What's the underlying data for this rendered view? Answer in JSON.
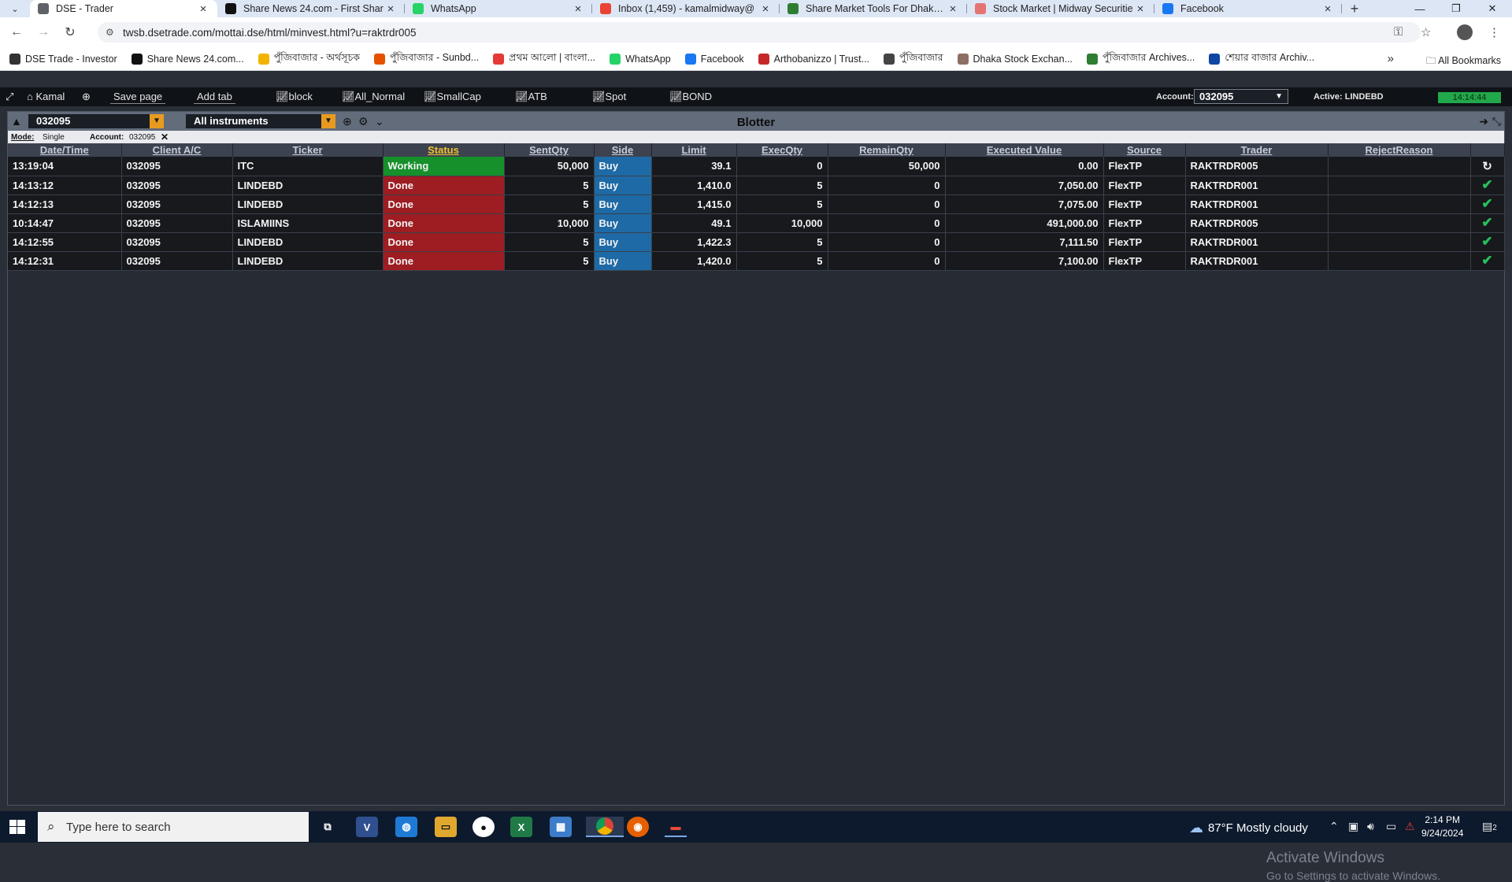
{
  "browser": {
    "tabs": [
      {
        "title": "DSE - Trader",
        "color": "#5f6368",
        "active": true
      },
      {
        "title": "Share News 24.com - First Shar",
        "color": "#111111"
      },
      {
        "title": "WhatsApp",
        "color": "#25d366"
      },
      {
        "title": "Inbox (1,459) - kamalmidway@",
        "color": "#ea4335"
      },
      {
        "title": "Share Market Tools For Dhaka S",
        "color": "#2e7d32"
      },
      {
        "title": "Stock Market | Midway Securitie",
        "color": "#e57373"
      },
      {
        "title": "Facebook",
        "color": "#1877f2"
      }
    ],
    "url": "twsb.dsetrade.com/mottai.dse/html/minvest.html?u=raktrdr005",
    "bookmarks": [
      {
        "label": "DSE Trade - Investor",
        "color": "#333333"
      },
      {
        "label": "Share News 24.com...",
        "color": "#111111"
      },
      {
        "label": "পুঁজিবাজার - অর্থসূচক",
        "color": "#f2b400"
      },
      {
        "label": "পুঁজিবাজার - Sunbd...",
        "color": "#e65100"
      },
      {
        "label": "প্রথম আলো | বাংলা...",
        "color": "#e53935"
      },
      {
        "label": "WhatsApp",
        "color": "#25d366"
      },
      {
        "label": "Facebook",
        "color": "#1877f2"
      },
      {
        "label": "Arthobanizzo | Trust...",
        "color": "#c62828"
      },
      {
        "label": "পুঁজিবাজার",
        "color": "#444444"
      },
      {
        "label": "Dhaka Stock Exchan...",
        "color": "#8d6e63"
      },
      {
        "label": "পুঁজিবাজার Archives...",
        "color": "#2e7d32"
      },
      {
        "label": "শেয়ার বাজার Archiv...",
        "color": "#0d47a1"
      }
    ],
    "all_bookmarks": "All Bookmarks"
  },
  "toolbar": {
    "user": "Kamal",
    "save_page": "Save page",
    "add_tab": "Add tab",
    "tabs": [
      "block",
      "All_Normal",
      "SmallCap",
      "ATB",
      "Spot",
      "BOND"
    ],
    "account_label": "Account:",
    "account_value": "032095",
    "active_label": "Active: LINDEBD",
    "clock": "14:14:44"
  },
  "blotter": {
    "title": "Blotter",
    "account_filter": "032095",
    "instrument_filter": "All instruments",
    "mode_label": "Mode:",
    "mode_value": "Single",
    "account_label": "Account:",
    "account_value": "032095",
    "columns": [
      "Date/Time",
      "Client A/C",
      "Ticker",
      "Status",
      "SentQty",
      "Side",
      "Limit",
      "ExecQty",
      "RemainQty",
      "Executed Value",
      "Source",
      "Trader",
      "RejectReason",
      ""
    ],
    "rows": [
      {
        "time": "13:19:04",
        "client": "032095",
        "ticker": "ITC",
        "status": "Working",
        "sent": "50,000",
        "side": "Buy",
        "limit": "39.1",
        "exec": "0",
        "remain": "50,000",
        "value": "0.00",
        "source": "FlexTP",
        "trader": "RAKTRDR005",
        "reject": "",
        "state": "↻"
      },
      {
        "time": "14:13:12",
        "client": "032095",
        "ticker": "LINDEBD",
        "status": "Done",
        "sent": "5",
        "side": "Buy",
        "limit": "1,410.0",
        "exec": "5",
        "remain": "0",
        "value": "7,050.00",
        "source": "FlexTP",
        "trader": "RAKTRDR001",
        "reject": "",
        "state": "✔"
      },
      {
        "time": "14:12:13",
        "client": "032095",
        "ticker": "LINDEBD",
        "status": "Done",
        "sent": "5",
        "side": "Buy",
        "limit": "1,415.0",
        "exec": "5",
        "remain": "0",
        "value": "7,075.00",
        "source": "FlexTP",
        "trader": "RAKTRDR001",
        "reject": "",
        "state": "✔"
      },
      {
        "time": "10:14:47",
        "client": "032095",
        "ticker": "ISLAMIINS",
        "status": "Done",
        "sent": "10,000",
        "side": "Buy",
        "limit": "49.1",
        "exec": "10,000",
        "remain": "0",
        "value": "491,000.00",
        "source": "FlexTP",
        "trader": "RAKTRDR005",
        "reject": "",
        "state": "✔"
      },
      {
        "time": "14:12:55",
        "client": "032095",
        "ticker": "LINDEBD",
        "status": "Done",
        "sent": "5",
        "side": "Buy",
        "limit": "1,422.3",
        "exec": "5",
        "remain": "0",
        "value": "7,111.50",
        "source": "FlexTP",
        "trader": "RAKTRDR001",
        "reject": "",
        "state": "✔"
      },
      {
        "time": "14:12:31",
        "client": "032095",
        "ticker": "LINDEBD",
        "status": "Done",
        "sent": "5",
        "side": "Buy",
        "limit": "1,420.0",
        "exec": "5",
        "remain": "0",
        "value": "7,100.00",
        "source": "FlexTP",
        "trader": "RAKTRDR001",
        "reject": "",
        "state": "✔"
      }
    ]
  },
  "watermark": {
    "line1": "Activate Windows",
    "line2": "Go to Settings to activate Windows."
  },
  "taskbar": {
    "search_placeholder": "Type here to search",
    "weather": "87°F  Mostly cloudy",
    "time": "2:14 PM",
    "date": "9/24/2024",
    "notifications": "2"
  }
}
